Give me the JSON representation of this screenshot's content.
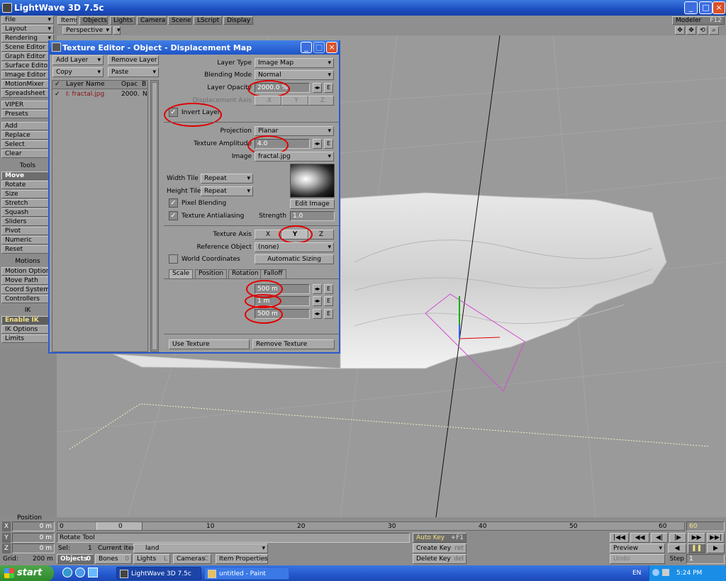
{
  "app": {
    "title": "LightWave 3D 7.5c"
  },
  "menubar": {
    "tabs": [
      "Items",
      "Objects",
      "Lights",
      "Camera",
      "Scene",
      "LScript",
      "Display"
    ],
    "right": "Modeler",
    "shortcut": "F12"
  },
  "viewport": {
    "view": "Perspective"
  },
  "left_panel": {
    "buttons": [
      "File",
      "Layout",
      "Rendering",
      "Scene Editor",
      "Graph Editor",
      "Surface Editor",
      "Image Editor",
      "MotionMixer",
      "Spreadsheet",
      "VIPER",
      "Presets",
      "Add",
      "Replace",
      "Select",
      "Clear"
    ],
    "tools_header": "Tools",
    "tools": [
      "Move",
      "Rotate",
      "Size",
      "Stretch",
      "Squash",
      "Sliders",
      "Pivot",
      "Numeric",
      "Reset"
    ],
    "motions_header": "Motions",
    "motions": [
      "Motion Options",
      "Move Path",
      "Coord System",
      "Controllers"
    ],
    "ik_header": "IK",
    "ik": [
      "Enable IK",
      "IK Options",
      "Limits"
    ]
  },
  "dialog": {
    "title": "Texture Editor - Object - Displacement Map",
    "add_layer": "Add Layer",
    "remove_layer": "Remove Layer",
    "copy": "Copy",
    "paste": "Paste",
    "list_headers": {
      "name": "Layer Name",
      "opac": "Opac",
      "b": "B"
    },
    "layer": {
      "name": "I: fractal.jpg",
      "opac": "2000.",
      "b": "N"
    },
    "layer_type_label": "Layer Type",
    "layer_type": "Image Map",
    "blending_label": "Blending Mode",
    "blending": "Normal",
    "opacity_label": "Layer Opacity",
    "opacity": "2000.0 %",
    "disp_axis_label": "Displacement Axis",
    "axes": [
      "X",
      "Y",
      "Z"
    ],
    "invert_label": "Invert Layer",
    "projection_label": "Projection",
    "projection": "Planar",
    "amplitude_label": "Texture Amplitude",
    "amplitude": "4.0",
    "image_label": "Image",
    "image": "fractal.jpg",
    "width_tile_label": "Width Tile",
    "width_tile": "Repeat",
    "height_tile_label": "Height Tile",
    "height_tile": "Repeat",
    "pixel_blending": "Pixel Blending",
    "edit_image": "Edit Image",
    "antialiasing": "Texture Antialiasing",
    "strength_label": "Strength",
    "strength": "1.0",
    "texture_axis_label": "Texture Axis",
    "ref_object_label": "Reference Object",
    "ref_object": "(none)",
    "world_coords": "World Coordinates",
    "auto_sizing": "Automatic Sizing",
    "tabs": [
      "Scale",
      "Position",
      "Rotation",
      "Falloff"
    ],
    "scale": [
      "500 m",
      "1 m",
      "500 m"
    ],
    "use_texture": "Use Texture",
    "remove_texture": "Remove Texture"
  },
  "bottom": {
    "position_label": "Position",
    "x": "0 m",
    "y": "0 m",
    "z": "0 m",
    "grid_label": "Grid:",
    "grid": "200 m",
    "timeline_ticks": [
      "0",
      "10",
      "20",
      "30",
      "40",
      "50",
      "60"
    ],
    "frame_start": "0",
    "frame_end": "60",
    "frame_current": "0",
    "status": "Rotate Tool",
    "sel_label": "Sel:",
    "sel": "1",
    "current_item_label": "Current Item",
    "current_item": "land",
    "objects": "Objects",
    "objects_n": "0",
    "bones": "Bones",
    "bones_n": "0",
    "lights": "Lights",
    "lights_n": "L",
    "cameras": "Cameras",
    "cameras_n": "C",
    "item_props": "Item Properties",
    "item_props_n": "p",
    "auto_key": "Auto Key",
    "auto_key_sc": "+F1",
    "create_key": "Create Key",
    "create_key_sc": "ret",
    "delete_key": "Delete Key",
    "delete_key_sc": "del",
    "preview": "Preview",
    "undo": "Undo",
    "step_label": "Step",
    "step": "1"
  },
  "taskbar": {
    "start": "start",
    "tasks": [
      "LightWave 3D 7.5c",
      "untitled - Paint"
    ],
    "lang": "EN",
    "time": "5:24 PM"
  }
}
